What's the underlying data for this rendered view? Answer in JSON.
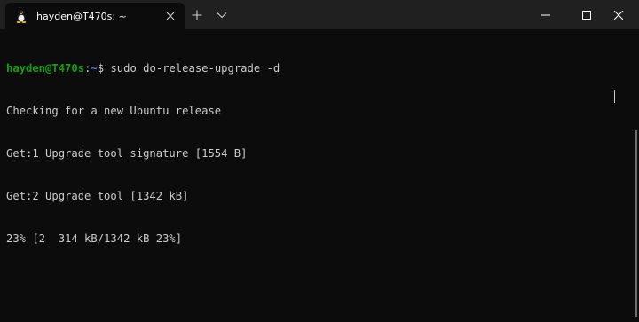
{
  "tab": {
    "title": "hayden@T470s: ~",
    "icon": "linux-tux-icon"
  },
  "prompt": {
    "user_host": "hayden@T470s",
    "colon": ":",
    "path": "~",
    "symbol": "$ ",
    "command": "sudo do-release-upgrade -d"
  },
  "output": [
    "Checking for a new Ubuntu release",
    "Get:1 Upgrade tool signature [1554 B]",
    "Get:2 Upgrade tool [1342 kB]",
    "23% [2  314 kB/1342 kB 23%]"
  ],
  "colors": {
    "background": "#0c0c0c",
    "titlebar": "#202020",
    "text": "#cccccc",
    "prompt_user": "#13a10e",
    "prompt_path": "#3b78ff"
  }
}
